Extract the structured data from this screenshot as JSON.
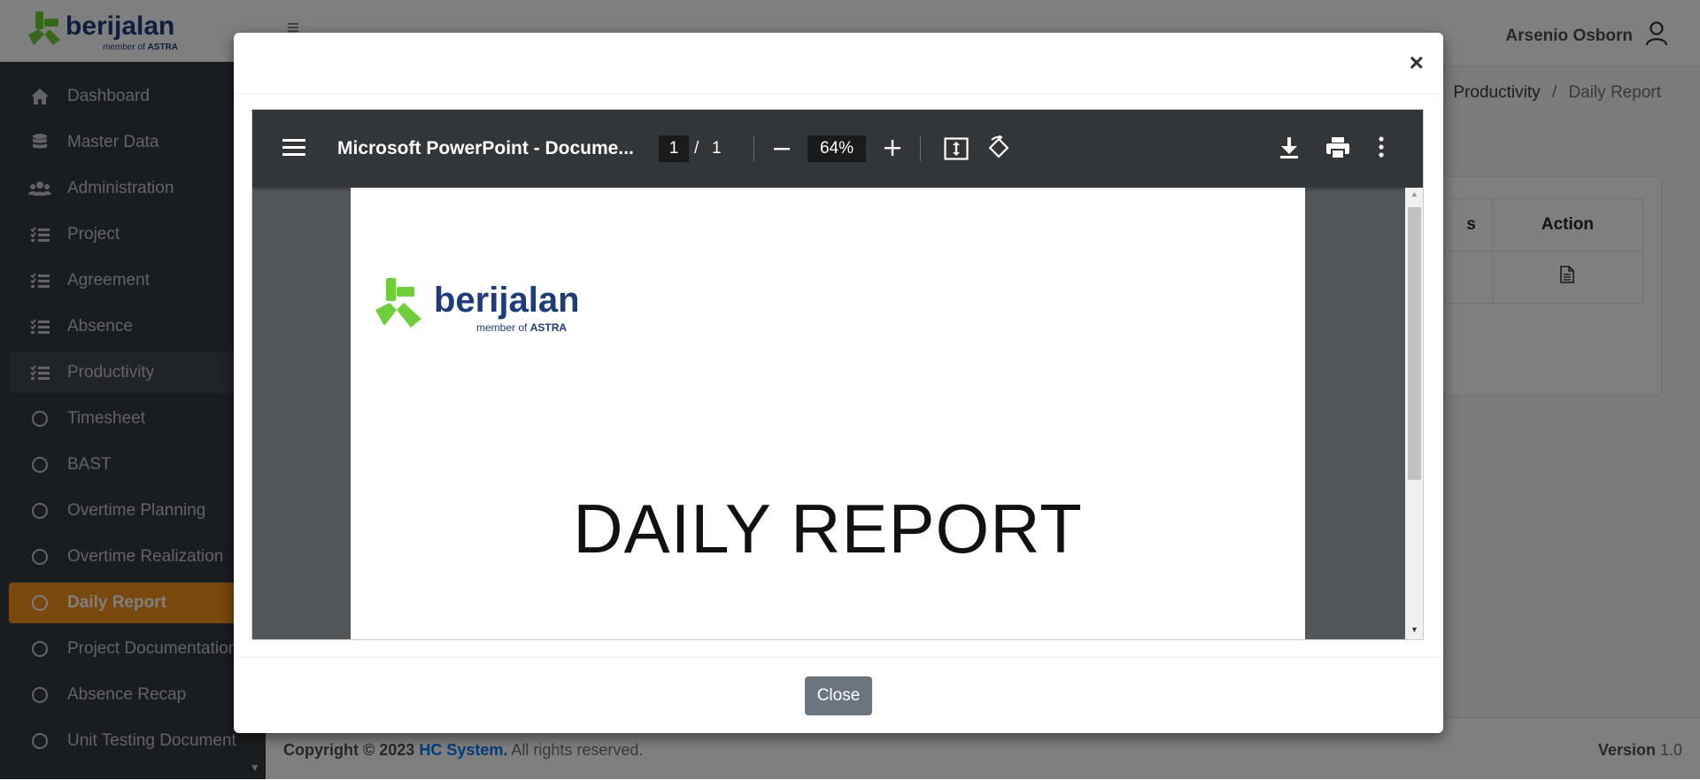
{
  "brand": {
    "name": "berijalan",
    "tagline_prefix": "member of",
    "tagline_company": "ASTRA"
  },
  "sidebar": {
    "items": [
      {
        "label": "Dashboard",
        "icon": "home-icon"
      },
      {
        "label": "Master Data",
        "icon": "database-icon"
      },
      {
        "label": "Administration",
        "icon": "users-icon"
      },
      {
        "label": "Project",
        "icon": "tasks-icon"
      },
      {
        "label": "Agreement",
        "icon": "tasks-icon"
      },
      {
        "label": "Absence",
        "icon": "tasks-icon"
      },
      {
        "label": "Productivity",
        "icon": "tasks-icon"
      },
      {
        "label": "Timesheet",
        "icon": "circle-icon"
      },
      {
        "label": "BAST",
        "icon": "circle-icon"
      },
      {
        "label": "Overtime Planning",
        "icon": "circle-icon"
      },
      {
        "label": "Overtime Realization",
        "icon": "circle-icon"
      },
      {
        "label": "Daily Report",
        "icon": "circle-icon"
      },
      {
        "label": "Project Documentation",
        "icon": "circle-icon"
      },
      {
        "label": "Absence Recap",
        "icon": "circle-icon"
      },
      {
        "label": "Unit Testing Document",
        "icon": "circle-icon"
      }
    ]
  },
  "header": {
    "user_name": "Arsenio Osborn"
  },
  "breadcrumb": {
    "parent": "Productivity",
    "current": "Daily Report",
    "separator": "/"
  },
  "table": {
    "headers": [
      "s",
      "Action"
    ]
  },
  "footer": {
    "copyright": "Copyright © 2023",
    "company": "HC System.",
    "rights": "All rights reserved.",
    "version_label": "Version",
    "version_value": "1.0"
  },
  "modal": {
    "close_label": "Close",
    "close_x": "×",
    "pdf_viewer": {
      "title": "Microsoft PowerPoint - Docume...",
      "page_current": "1",
      "page_separator": "/",
      "page_total": "1",
      "zoom": "64%",
      "document_title": "DAILY REPORT"
    }
  },
  "colors": {
    "sidebar_bg": "#343a40",
    "active_item": "#f0901f",
    "brand_blue": "#1d3c78",
    "brand_green": "#7ed957",
    "pdf_toolbar": "#323639",
    "close_button": "#6c757d"
  }
}
